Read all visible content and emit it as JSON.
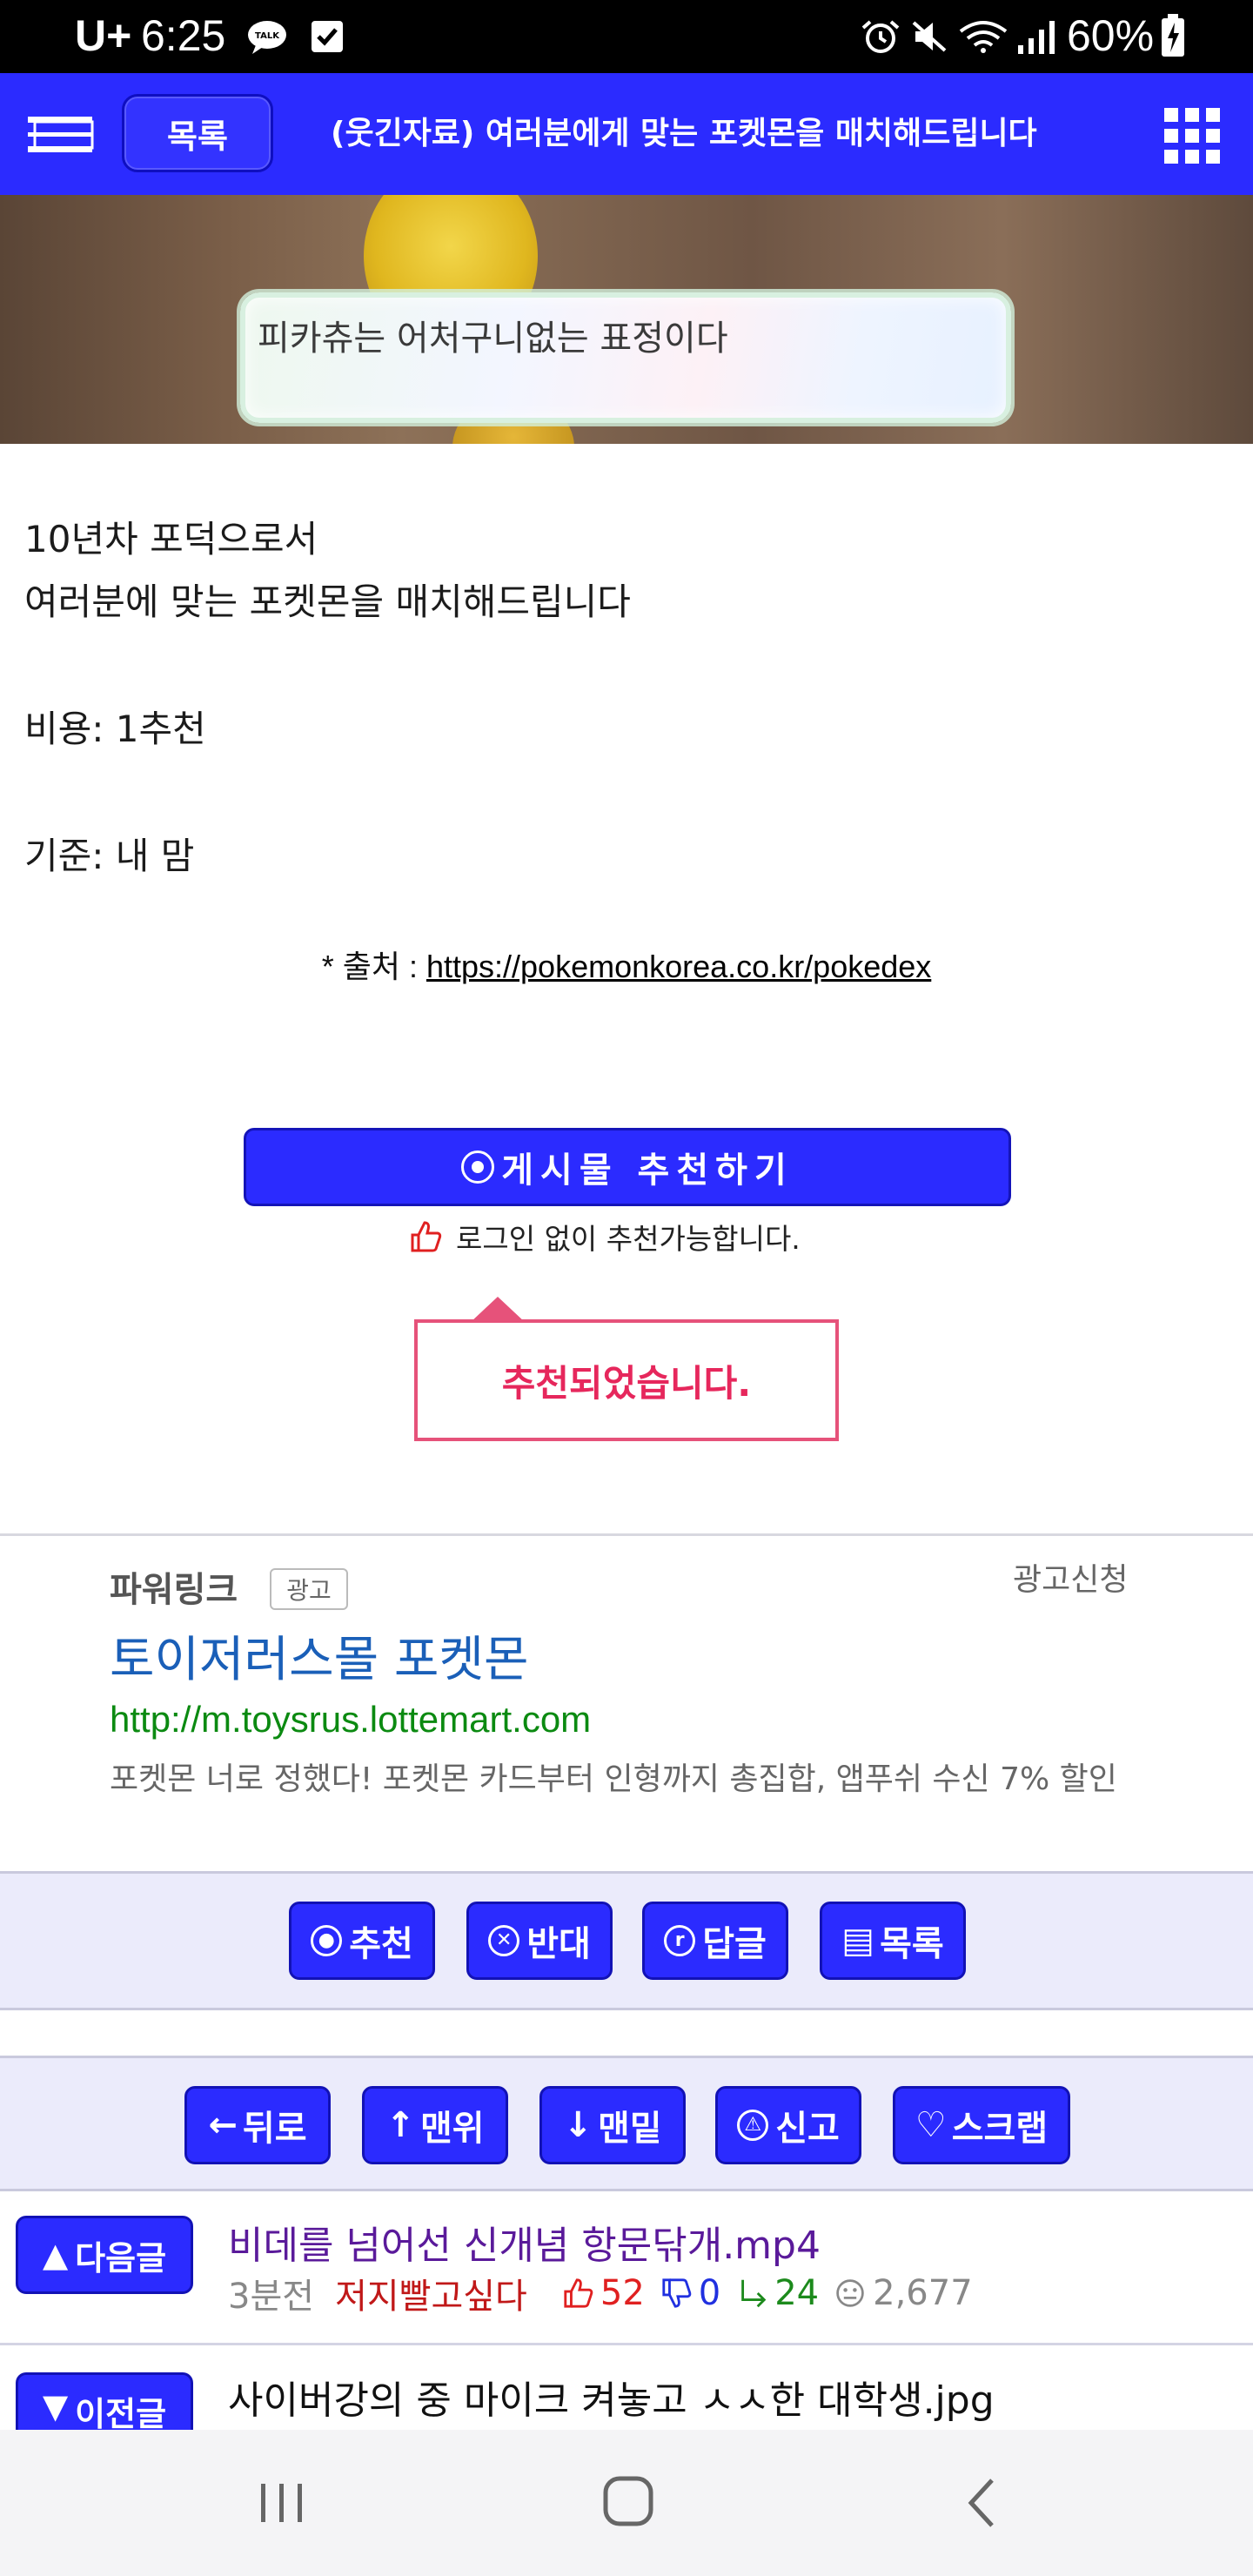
{
  "status_bar": {
    "carrier": "U+",
    "time": "6:25",
    "battery": "60%"
  },
  "header": {
    "list_label": "목록",
    "title": "(웃긴자료) 여러분에게 맞는 포켓몬을 매치해드립니다"
  },
  "banner": {
    "dialog_text": "피카츄는 어처구니없는 표정이다"
  },
  "post": {
    "lines": [
      "10년차 포덕으로서",
      "여러분에 맞는 포켓몬을 매치해드립니다",
      "비용: 1추천",
      "기준: 내 맘"
    ],
    "source_prefix": "* 출처 : ",
    "source_url": "https://pokemonkorea.co.kr/pokedex"
  },
  "recommend": {
    "button_label": "게시물  추천하기",
    "note": "로그인 없이 추천가능합니다.",
    "done_message": "추천되었습니다."
  },
  "ad": {
    "label": "파워링크",
    "tag": "광고",
    "apply": "광고신청",
    "title": "토이저러스몰 포켓몬",
    "url": "http://m.toysrus.lottemart.com",
    "description": "포켓몬 너로 정했다! 포켓몬 카드부터 인형까지 총집합, 앱푸쉬 수신 7% 할인"
  },
  "actions": {
    "recommend": "추천",
    "oppose": "반대",
    "reply": "답글",
    "list": "목록",
    "back": "뒤로",
    "top": "맨위",
    "bottom": "맨밑",
    "report": "신고",
    "scrap": "스크랩"
  },
  "next_post": {
    "button_label": "다음글",
    "title": "비데를 넘어선 신개념 항문닦개.mp4",
    "time_ago": "3분전",
    "author": "저지빨고싶다",
    "likes": "52",
    "dislikes": "0",
    "replies": "24",
    "views": "2,677"
  },
  "prev_post": {
    "button_label": "이전글",
    "title": "사이버강의 중 마이크 켜놓고 ㅅㅅ한 대학생.jpg"
  },
  "colors": {
    "accent": "#2b2bff",
    "visited_title": "#5a1a9a",
    "author": "#c01818",
    "likes": "#e02020",
    "dislikes": "#2030e0",
    "replies": "#1c8a1c"
  }
}
